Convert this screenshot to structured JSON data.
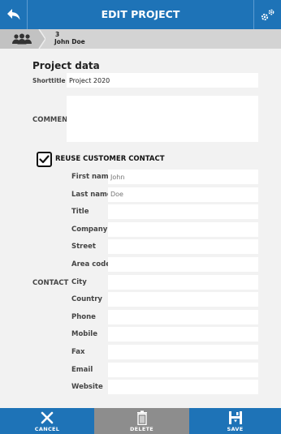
{
  "header": {
    "title": "EDIT PROJECT",
    "back_icon": "back-arrow-icon",
    "settings_icon": "gears-icon"
  },
  "breadcrumb": {
    "icon": "people-group-icon",
    "count": "3",
    "name": "John Doe"
  },
  "project": {
    "section_title": "Project data",
    "shorttitle_label": "Shorttitle",
    "shorttitle_value": "Project 2020",
    "comment_label": "COMMENT",
    "comment_value": ""
  },
  "contact": {
    "reuse_label": "REUSE CUSTOMER CONTACT",
    "reuse_checked": true,
    "group_label": "CONTACT",
    "fields": [
      {
        "label": "First name",
        "value": "",
        "placeholder": "John"
      },
      {
        "label": "Last name",
        "value": "",
        "placeholder": "Doe"
      },
      {
        "label": "Title",
        "value": "",
        "placeholder": ""
      },
      {
        "label": "Company",
        "value": "",
        "placeholder": ""
      },
      {
        "label": "Street",
        "value": "",
        "placeholder": ""
      },
      {
        "label": "Area code",
        "value": "",
        "placeholder": ""
      },
      {
        "label": "City",
        "value": "",
        "placeholder": ""
      },
      {
        "label": "Country",
        "value": "",
        "placeholder": ""
      },
      {
        "label": "Phone",
        "value": "",
        "placeholder": ""
      },
      {
        "label": "Mobile",
        "value": "",
        "placeholder": ""
      },
      {
        "label": "Fax",
        "value": "",
        "placeholder": ""
      },
      {
        "label": "Email",
        "value": "",
        "placeholder": ""
      },
      {
        "label": "Website",
        "value": "",
        "placeholder": ""
      }
    ]
  },
  "actions": {
    "cancel_label": "CANCEL",
    "delete_label": "DELETE",
    "save_label": "SAVE"
  },
  "colors": {
    "primary": "#1e73b7",
    "disabled": "#8d8d8d"
  }
}
